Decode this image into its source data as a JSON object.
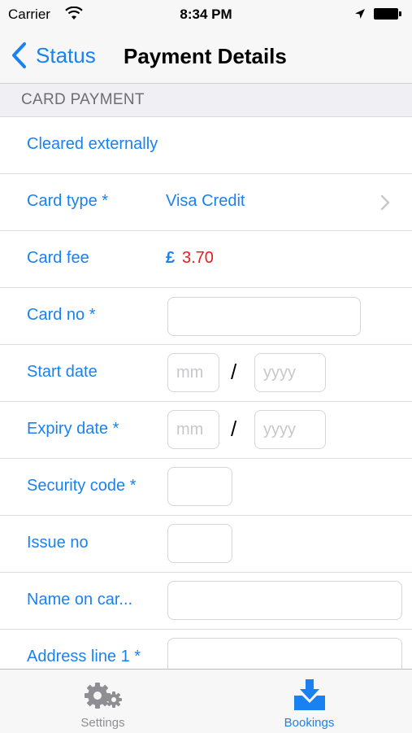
{
  "status_bar": {
    "carrier": "Carrier",
    "time": "8:34 PM"
  },
  "nav": {
    "back_label": "Status",
    "title": "Payment Details"
  },
  "section": {
    "header": "CARD PAYMENT"
  },
  "rows": {
    "cleared": "Cleared externally",
    "card_type_label": "Card type *",
    "card_type_value": "Visa Credit",
    "card_fee_label": "Card fee",
    "card_fee_currency": "£",
    "card_fee_amount": "3.70",
    "card_no_label": "Card no *",
    "start_date_label": "Start date",
    "expiry_date_label": "Expiry date *",
    "security_code_label": "Security code *",
    "issue_no_label": "Issue no",
    "name_on_card_label": "Name on car...",
    "address_line1_label": "Address line 1 *"
  },
  "placeholders": {
    "month": "mm",
    "year": "yyyy"
  },
  "date_separator": "/",
  "tabs": [
    {
      "label": "Settings",
      "icon": "gear-icon",
      "selected": false
    },
    {
      "label": "Bookings",
      "icon": "download-tray-icon",
      "selected": true
    }
  ],
  "colors": {
    "accent": "#1a82f0",
    "fee_amount": "#e02020",
    "label": "#1a82f0",
    "tab_inactive": "#8e8e93",
    "section_bg": "#efeff4"
  }
}
